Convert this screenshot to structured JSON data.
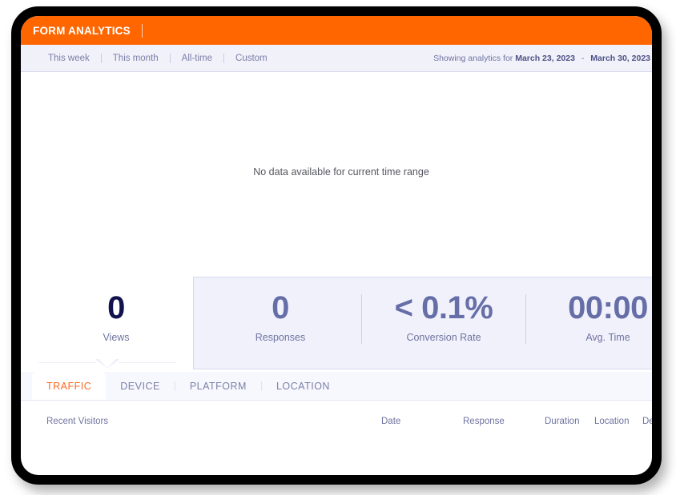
{
  "titlebar": {
    "title": "FORM ANALYTICS"
  },
  "filterbar": {
    "ranges": [
      {
        "label": "This week"
      },
      {
        "label": "This month"
      },
      {
        "label": "All-time"
      },
      {
        "label": "Custom"
      }
    ],
    "showing_prefix": "Showing analytics for",
    "start_date": "March 23, 2023",
    "date_separator": "-",
    "end_date": "March 30, 2023"
  },
  "chart": {
    "empty_message": "No data available for current time range"
  },
  "stats": [
    {
      "value": "0",
      "label": "Views"
    },
    {
      "value": "0",
      "label": "Responses"
    },
    {
      "value": "< 0.1%",
      "label": "Conversion Rate"
    },
    {
      "value": "00:00",
      "label": "Avg. Time"
    }
  ],
  "tabs": [
    {
      "label": "TRAFFIC",
      "active": true
    },
    {
      "label": "DEVICE",
      "active": false
    },
    {
      "label": "PLATFORM",
      "active": false
    },
    {
      "label": "LOCATION",
      "active": false
    }
  ],
  "table": {
    "section_title": "Recent Visitors",
    "columns": [
      {
        "label": "Date"
      },
      {
        "label": "Response"
      },
      {
        "label": "Duration"
      },
      {
        "label": "Location"
      },
      {
        "label": "Device"
      }
    ],
    "rows": []
  },
  "colors": {
    "accent_orange": "#ff6600",
    "tab_active_orange": "#ff6a20",
    "views_navy": "#12134c",
    "stat_purple": "#666ea8",
    "panel_bg": "#f1f1fb",
    "filterbar_bg": "#f1f1fa"
  }
}
